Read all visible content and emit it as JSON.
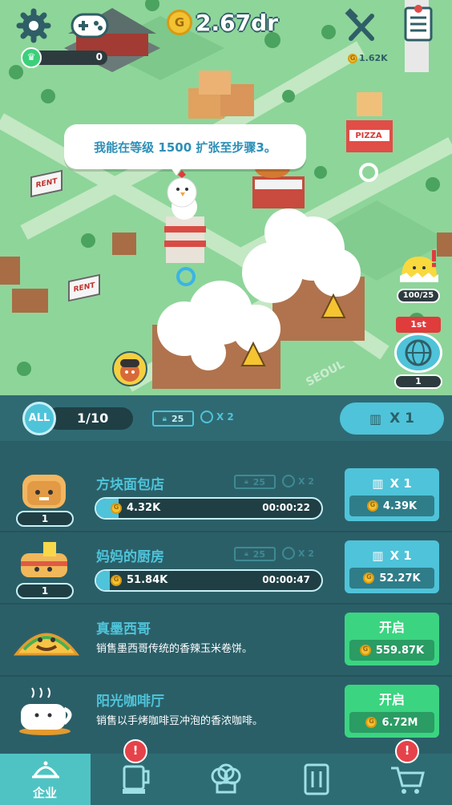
{
  "hud": {
    "currency": "2.67dr",
    "level_value": "0",
    "pizza_income": "1.62K",
    "bubble": "我能在等级 1500 扩张至步骤3。",
    "chick_counter": "100/25",
    "rank_label": "1st",
    "rank_value": "1"
  },
  "map_signs": {
    "rent1": "RENT",
    "rent2": "RENT",
    "pizza": "PIZZA",
    "street": "SEOUL"
  },
  "panel_header": {
    "filter_label": "ALL",
    "progress": "1/10",
    "level_value": "25",
    "speed_label": "X 2",
    "multiplier_button": "X 1"
  },
  "partial_row": {
    "count": "2"
  },
  "businesses": [
    {
      "name": "方块面包店",
      "level": "1",
      "lock": "25",
      "speed": "X 2",
      "income": "4.32K",
      "timer": "00:00:22",
      "btn_top": "X 1",
      "btn_cost": "4.39K",
      "progress": 0.1
    },
    {
      "name": "妈妈的厨房",
      "level": "1",
      "lock": "25",
      "speed": "X 2",
      "income": "51.84K",
      "timer": "00:00:47",
      "btn_top": "X 1",
      "btn_cost": "52.27K",
      "progress": 0.06
    }
  ],
  "locked": [
    {
      "name": "真墨西哥",
      "desc": "销售墨西哥传统的香辣玉米卷饼。",
      "btn_label": "开启",
      "cost": "559.87K"
    },
    {
      "name": "阳光咖啡厅",
      "desc": "销售以手烤咖啡豆冲泡的香浓咖啡。",
      "btn_label": "开启",
      "cost": "6.72M"
    }
  ],
  "tabs": {
    "active_label": "企业",
    "badge": "!"
  },
  "colors": {
    "panel": "#2b5f68",
    "accent": "#4fc3d9",
    "green_button": "#3bd481",
    "tab_active": "#4fc3c3",
    "map_grass": "#8fd39a"
  }
}
